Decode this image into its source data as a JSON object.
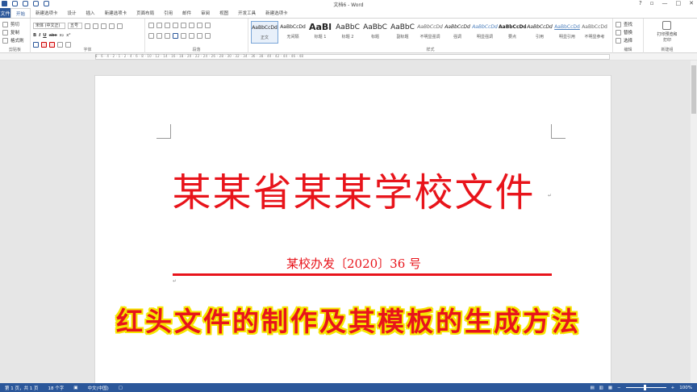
{
  "titlebar": {
    "title": "文档6 - Word",
    "help": "?",
    "minimize": "—",
    "restore": "□",
    "close": "✕"
  },
  "tabs": {
    "file": "文件",
    "items": [
      "开始",
      "新建选项卡",
      "设计",
      "插入",
      "新建选项卡",
      "页面布局",
      "引用",
      "邮件",
      "审阅",
      "视图",
      "开发工具",
      "新建选项卡"
    ]
  },
  "ribbon": {
    "clipboard": {
      "cut": "剪切",
      "copy": "复制",
      "format_painter": "格式刷",
      "label": "剪贴板"
    },
    "font": {
      "font_name": "宋体 (中文正)",
      "font_size": "五号",
      "label": "字体",
      "bold": "B",
      "italic": "I",
      "underline": "U",
      "strike": "abc",
      "sub": "x₂",
      "sup": "x²"
    },
    "paragraph": {
      "label": "段落"
    },
    "styles": {
      "label": "样式",
      "items": [
        {
          "sample": "AaBbCcDd",
          "name": "正文"
        },
        {
          "sample": "AaBbCcDd",
          "name": "无间隔"
        },
        {
          "sample": "AaBl",
          "name": "标题 1"
        },
        {
          "sample": "AaBbC",
          "name": "标题 2"
        },
        {
          "sample": "AaBbC",
          "name": "标题"
        },
        {
          "sample": "AaBbC",
          "name": "副标题"
        },
        {
          "sample": "AaBbCcDd",
          "name": "不明显强调"
        },
        {
          "sample": "AaBbCcDd",
          "name": "强调"
        },
        {
          "sample": "AaBbCcDd",
          "name": "明显强调"
        },
        {
          "sample": "AaBbCcDd",
          "name": "要点"
        },
        {
          "sample": "AaBbCcDd",
          "name": "引用"
        },
        {
          "sample": "AaBbCcDd",
          "name": "明显引用"
        },
        {
          "sample": "AaBbCcDd",
          "name": "不明显参考"
        }
      ]
    },
    "editing": {
      "find": "查找",
      "replace": "替换",
      "select": "选择",
      "label": "编辑"
    },
    "print_preview": {
      "line1": "打印预览和",
      "line2": "打印",
      "label": "新建组"
    }
  },
  "ruler": {
    "ticks": "8 · 6 · 4 · 2 · 1 · 2 · 4 · 6 · 8 · 10 · 12 · 14 · 16 · 18 · 20 · 22 · 24 · 26 · 28 · 30 · 32 · 34 · 36 · 38 · 40 · 42 · 44 · 46 · 48"
  },
  "document": {
    "title": "某某省某某学校文件",
    "doc_number": "某校办发〔2020〕36 号",
    "paragraph_mark": "↵"
  },
  "overlay": {
    "caption": "红头文件的制作及其模板的生成方法"
  },
  "statusbar": {
    "page": "第 1 页，共 1 页",
    "words": "18 个字",
    "language": "中文(中国)",
    "zoom": "100%"
  },
  "colors": {
    "accent": "#2b579a",
    "red_header": "#e8141b",
    "caption_outline": "#f5e600"
  }
}
